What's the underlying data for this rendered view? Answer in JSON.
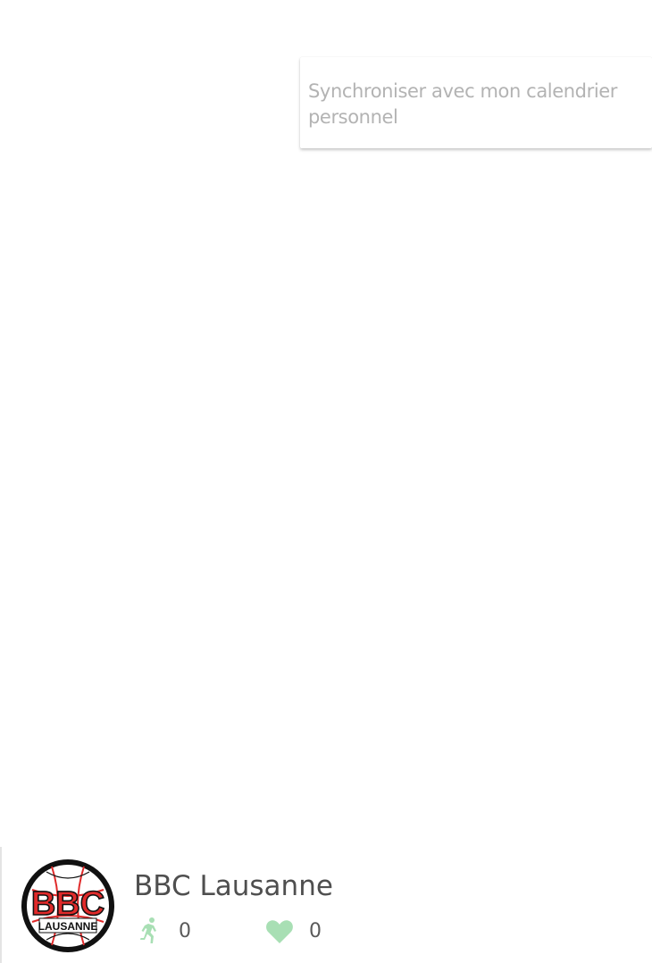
{
  "popup_menu": {
    "items": [
      {
        "label": "Synchroniser avec mon calendrier personnel"
      }
    ]
  },
  "club_card": {
    "name": "BBC Lausanne",
    "logo": {
      "icon": "bbc-lausanne-logo",
      "text_main": "BBC",
      "text_sub": "LAUSANNE"
    },
    "stats": {
      "followers": {
        "icon": "running-person-icon",
        "count": "0"
      },
      "likes": {
        "icon": "heart-icon",
        "count": "0"
      }
    },
    "colors": {
      "icon_green": "#a8dfb4",
      "logo_red": "#e02a2a"
    }
  }
}
